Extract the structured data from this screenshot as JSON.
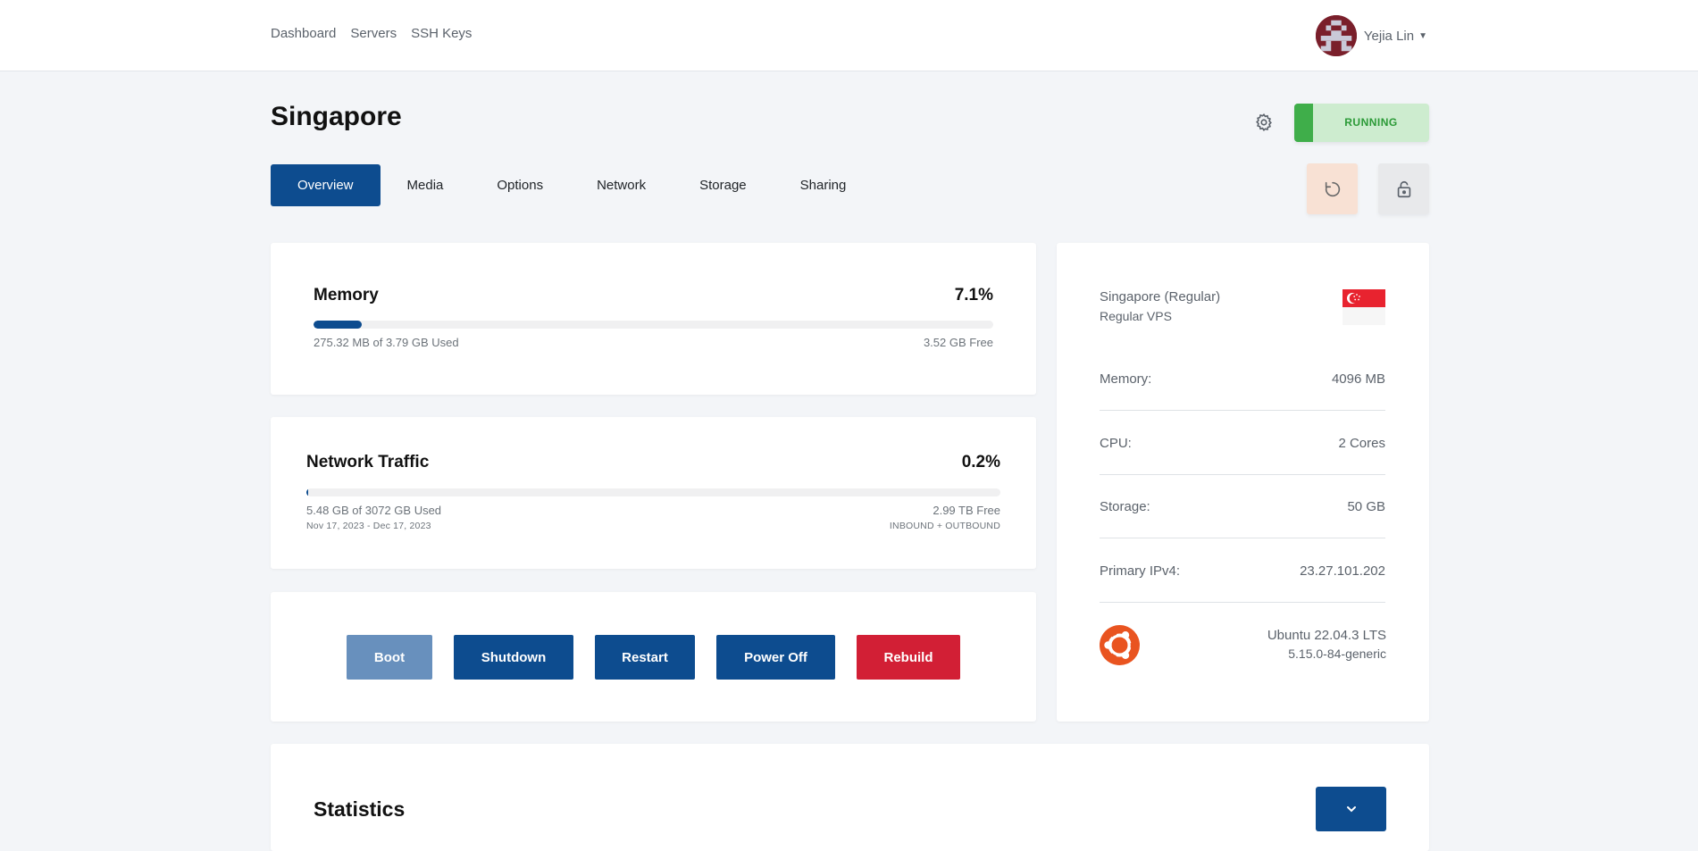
{
  "nav": {
    "links": [
      "Dashboard",
      "Servers",
      "SSH Keys"
    ],
    "user": {
      "name": "Yejia Lin",
      "avatar_icon": "pixel-avatar",
      "avatar_color": "#7a1f2b"
    }
  },
  "header": {
    "title": "Singapore",
    "settings_icon": "gear-icon",
    "status": {
      "label": "RUNNING",
      "color": "#3fae4a",
      "bg": "#cdeccf"
    }
  },
  "tabs": [
    {
      "label": "Overview",
      "active": true
    },
    {
      "label": "Media",
      "active": false
    },
    {
      "label": "Options",
      "active": false
    },
    {
      "label": "Network",
      "active": false
    },
    {
      "label": "Storage",
      "active": false
    },
    {
      "label": "Sharing",
      "active": false
    }
  ],
  "quick_actions": {
    "restart_icon": "restart-icon",
    "lock_icon": "lock-icon"
  },
  "memory": {
    "title": "Memory",
    "percent_label": "7.1%",
    "percent": 7.1,
    "used_text": "275.32 MB of 3.79 GB Used",
    "free_text": "3.52 GB Free"
  },
  "traffic": {
    "title": "Network Traffic",
    "percent_label": "0.2%",
    "percent": 0.2,
    "used_text": "5.48 GB of 3072 GB Used",
    "free_text": "2.99 TB Free",
    "period": "Nov 17, 2023 - Dec 17, 2023",
    "direction": "INBOUND + OUTBOUND"
  },
  "power": {
    "boot": "Boot",
    "shutdown": "Shutdown",
    "restart": "Restart",
    "poweroff": "Power Off",
    "rebuild": "Rebuild"
  },
  "specs": {
    "location": "Singapore (Regular)",
    "plan": "Regular VPS",
    "flag_icon": "singapore-flag",
    "rows": [
      {
        "key": "Memory:",
        "value": "4096 MB"
      },
      {
        "key": "CPU:",
        "value": "2 Cores"
      },
      {
        "key": "Storage:",
        "value": "50 GB"
      },
      {
        "key": "Primary IPv4:",
        "value": "23.27.101.202"
      }
    ],
    "os": {
      "icon": "ubuntu-icon",
      "name": "Ubuntu 22.04.3 LTS",
      "kernel": "5.15.0-84-generic"
    }
  },
  "statistics": {
    "title": "Statistics",
    "toggle_icon": "chevron-down-icon"
  },
  "colors": {
    "primary": "#0d4c8f",
    "danger": "#d21f35",
    "boot_disabled": "#6890bd",
    "ubuntu": "#e95420"
  }
}
